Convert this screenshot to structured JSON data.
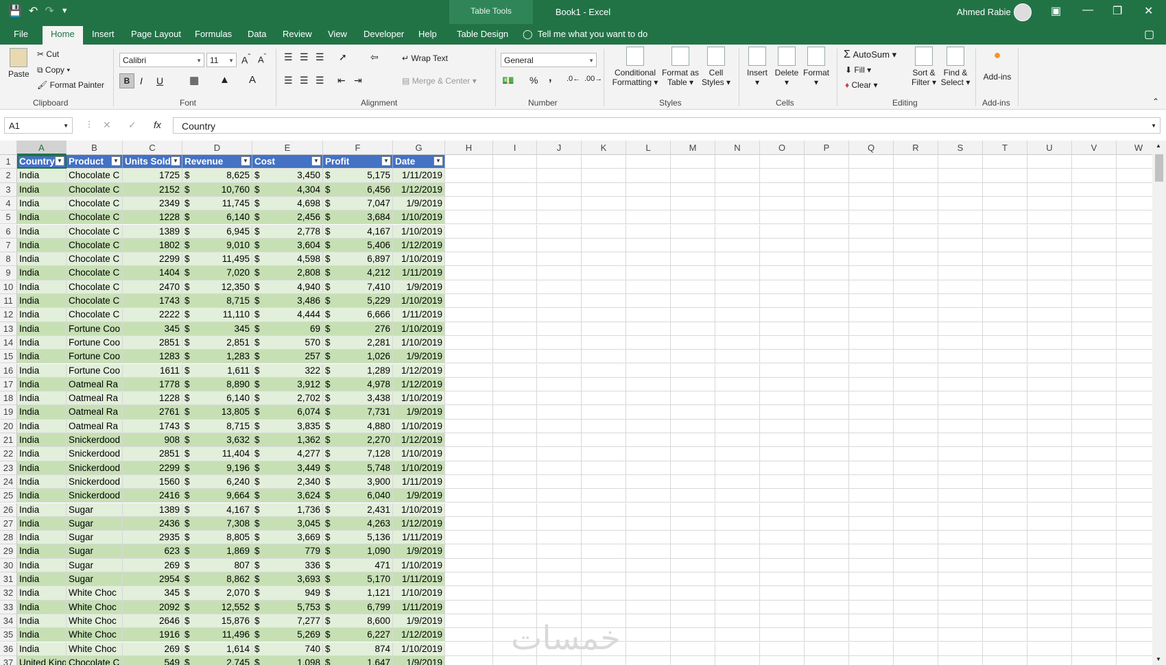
{
  "titlebar": {
    "title": "Book1  -  Excel",
    "context_tab_group": "Table Tools",
    "user_name": "Ahmed Rabie"
  },
  "menu": {
    "tabs": [
      "File",
      "Home",
      "Insert",
      "Page Layout",
      "Formulas",
      "Data",
      "Review",
      "View",
      "Developer",
      "Help",
      "Table Design"
    ],
    "tell_me": "Tell me what you want to do"
  },
  "ribbon": {
    "clipboard": {
      "paste": "Paste",
      "cut": "Cut",
      "copy": "Copy",
      "format_painter": "Format Painter",
      "label": "Clipboard"
    },
    "font": {
      "name": "Calibri",
      "size": "11",
      "bold": "B",
      "italic": "I",
      "underline": "U",
      "label": "Font"
    },
    "alignment": {
      "wrap_text": "Wrap Text",
      "merge_center": "Merge & Center",
      "label": "Alignment"
    },
    "number": {
      "format": "General",
      "percent": "%",
      "comma": ",",
      "label": "Number"
    },
    "styles": {
      "conditional": "Conditional",
      "conditional2": "Formatting",
      "format_table": "Format as",
      "format_table2": "Table",
      "cell_styles": "Cell",
      "cell_styles2": "Styles",
      "label": "Styles"
    },
    "cells": {
      "insert": "Insert",
      "delete": "Delete",
      "format": "Format",
      "label": "Cells"
    },
    "editing": {
      "autosum": "AutoSum",
      "fill": "Fill",
      "clear": "Clear",
      "sort": "Sort &",
      "sort2": "Filter",
      "find": "Find &",
      "find2": "Select",
      "label": "Editing"
    },
    "addins": {
      "addins": "Add-ins",
      "label": "Add-ins"
    }
  },
  "formula_bar": {
    "name_box": "A1",
    "fx": "fx",
    "content": "Country"
  },
  "columns": [
    "A",
    "B",
    "C",
    "D",
    "E",
    "F",
    "G",
    "H",
    "I",
    "J",
    "K",
    "L",
    "M",
    "N",
    "O",
    "P",
    "Q",
    "R",
    "S",
    "T",
    "U",
    "V",
    "W"
  ],
  "table": {
    "headers": [
      "Country",
      "Product",
      "Units Sold",
      "Revenue",
      "Cost",
      "Profit",
      "Date"
    ],
    "rows": [
      [
        "India",
        "Chocolate C",
        "1725",
        "8,625",
        "3,450",
        "5,175",
        "1/11/2019"
      ],
      [
        "India",
        "Chocolate C",
        "2152",
        "10,760",
        "4,304",
        "6,456",
        "1/12/2019"
      ],
      [
        "India",
        "Chocolate C",
        "2349",
        "11,745",
        "4,698",
        "7,047",
        "1/9/2019"
      ],
      [
        "India",
        "Chocolate C",
        "1228",
        "6,140",
        "2,456",
        "3,684",
        "1/10/2019"
      ],
      [
        "India",
        "Chocolate C",
        "1389",
        "6,945",
        "2,778",
        "4,167",
        "1/10/2019"
      ],
      [
        "India",
        "Chocolate C",
        "1802",
        "9,010",
        "3,604",
        "5,406",
        "1/12/2019"
      ],
      [
        "India",
        "Chocolate C",
        "2299",
        "11,495",
        "4,598",
        "6,897",
        "1/10/2019"
      ],
      [
        "India",
        "Chocolate C",
        "1404",
        "7,020",
        "2,808",
        "4,212",
        "1/11/2019"
      ],
      [
        "India",
        "Chocolate C",
        "2470",
        "12,350",
        "4,940",
        "7,410",
        "1/9/2019"
      ],
      [
        "India",
        "Chocolate C",
        "1743",
        "8,715",
        "3,486",
        "5,229",
        "1/10/2019"
      ],
      [
        "India",
        "Chocolate C",
        "2222",
        "11,110",
        "4,444",
        "6,666",
        "1/11/2019"
      ],
      [
        "India",
        "Fortune Coo",
        "345",
        "345",
        "69",
        "276",
        "1/10/2019"
      ],
      [
        "India",
        "Fortune Coo",
        "2851",
        "2,851",
        "570",
        "2,281",
        "1/10/2019"
      ],
      [
        "India",
        "Fortune Coo",
        "1283",
        "1,283",
        "257",
        "1,026",
        "1/9/2019"
      ],
      [
        "India",
        "Fortune Coo",
        "1611",
        "1,611",
        "322",
        "1,289",
        "1/12/2019"
      ],
      [
        "India",
        "Oatmeal Ra",
        "1778",
        "8,890",
        "3,912",
        "4,978",
        "1/12/2019"
      ],
      [
        "India",
        "Oatmeal Ra",
        "1228",
        "6,140",
        "2,702",
        "3,438",
        "1/10/2019"
      ],
      [
        "India",
        "Oatmeal Ra",
        "2761",
        "13,805",
        "6,074",
        "7,731",
        "1/9/2019"
      ],
      [
        "India",
        "Oatmeal Ra",
        "1743",
        "8,715",
        "3,835",
        "4,880",
        "1/10/2019"
      ],
      [
        "India",
        "Snickerdood",
        "908",
        "3,632",
        "1,362",
        "2,270",
        "1/12/2019"
      ],
      [
        "India",
        "Snickerdood",
        "2851",
        "11,404",
        "4,277",
        "7,128",
        "1/10/2019"
      ],
      [
        "India",
        "Snickerdood",
        "2299",
        "9,196",
        "3,449",
        "5,748",
        "1/10/2019"
      ],
      [
        "India",
        "Snickerdood",
        "1560",
        "6,240",
        "2,340",
        "3,900",
        "1/11/2019"
      ],
      [
        "India",
        "Snickerdood",
        "2416",
        "9,664",
        "3,624",
        "6,040",
        "1/9/2019"
      ],
      [
        "India",
        "Sugar",
        "1389",
        "4,167",
        "1,736",
        "2,431",
        "1/10/2019"
      ],
      [
        "India",
        "Sugar",
        "2436",
        "7,308",
        "3,045",
        "4,263",
        "1/12/2019"
      ],
      [
        "India",
        "Sugar",
        "2935",
        "8,805",
        "3,669",
        "5,136",
        "1/11/2019"
      ],
      [
        "India",
        "Sugar",
        "623",
        "1,869",
        "779",
        "1,090",
        "1/9/2019"
      ],
      [
        "India",
        "Sugar",
        "269",
        "807",
        "336",
        "471",
        "1/10/2019"
      ],
      [
        "India",
        "Sugar",
        "2954",
        "8,862",
        "3,693",
        "5,170",
        "1/11/2019"
      ],
      [
        "India",
        "White Choc",
        "345",
        "2,070",
        "949",
        "1,121",
        "1/10/2019"
      ],
      [
        "India",
        "White Choc",
        "2092",
        "12,552",
        "5,753",
        "6,799",
        "1/11/2019"
      ],
      [
        "India",
        "White Choc",
        "2646",
        "15,876",
        "7,277",
        "8,600",
        "1/9/2019"
      ],
      [
        "India",
        "White Choc",
        "1916",
        "11,496",
        "5,269",
        "6,227",
        "1/12/2019"
      ],
      [
        "India",
        "White Choc",
        "269",
        "1,614",
        "740",
        "874",
        "1/10/2019"
      ],
      [
        "United King",
        "Chocolate C",
        "549",
        "2,745",
        "1,098",
        "1,647",
        "1/9/2019"
      ]
    ]
  },
  "currency_symbol": "$",
  "watermark": "خمسات"
}
